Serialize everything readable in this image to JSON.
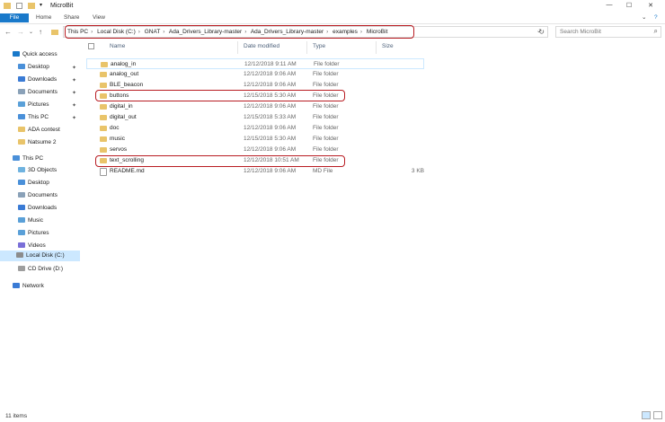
{
  "window": {
    "title": "MicroBit",
    "controls": {
      "minimize": "—",
      "maximize": "☐",
      "close": "✕"
    }
  },
  "ribbon": {
    "tabs": [
      "File",
      "Home",
      "Share",
      "View"
    ],
    "expand": "⌄",
    "help": "?"
  },
  "nav": {
    "back": "←",
    "forward": "→",
    "recent": "⌄",
    "up": "↑",
    "breadcrumb": [
      "This PC",
      "Local Disk (C:)",
      "GNAT",
      "Ada_Drivers_Library-master",
      "Ada_Drivers_Library-master",
      "examples",
      "MicroBit"
    ],
    "refresh": "↻",
    "search_placeholder": "Search MicroBit"
  },
  "sidebar": {
    "quick_access": "Quick access",
    "quick_items": [
      "Desktop",
      "Downloads",
      "Documents",
      "Pictures",
      "This PC",
      "ADA contest",
      "Natsume 2"
    ],
    "this_pc": "This PC",
    "pc_items": [
      "3D Objects",
      "Desktop",
      "Documents",
      "Downloads",
      "Music",
      "Pictures",
      "Videos",
      "Local Disk (C:)",
      "CD Drive (D:)"
    ],
    "network": "Network"
  },
  "columns": {
    "name": "Name",
    "date": "Date modified",
    "type": "Type",
    "size": "Size"
  },
  "files": [
    {
      "name": "analog_in",
      "date": "12/12/2018 9:11 AM",
      "type": "File folder",
      "size": ""
    },
    {
      "name": "analog_out",
      "date": "12/12/2018 9:06 AM",
      "type": "File folder",
      "size": ""
    },
    {
      "name": "BLE_beacon",
      "date": "12/12/2018 9:06 AM",
      "type": "File folder",
      "size": ""
    },
    {
      "name": "buttons",
      "date": "12/15/2018 5:30 AM",
      "type": "File folder",
      "size": ""
    },
    {
      "name": "digital_in",
      "date": "12/12/2018 9:06 AM",
      "type": "File folder",
      "size": ""
    },
    {
      "name": "digital_out",
      "date": "12/15/2018 5:33 AM",
      "type": "File folder",
      "size": ""
    },
    {
      "name": "doc",
      "date": "12/12/2018 9:06 AM",
      "type": "File folder",
      "size": ""
    },
    {
      "name": "music",
      "date": "12/15/2018 5:30 AM",
      "type": "File folder",
      "size": ""
    },
    {
      "name": "servos",
      "date": "12/12/2018 9:06 AM",
      "type": "File folder",
      "size": ""
    },
    {
      "name": "text_scrolling",
      "date": "12/12/2018 10:51 AM",
      "type": "File folder",
      "size": ""
    },
    {
      "name": "README.md",
      "date": "12/12/2018 9:06 AM",
      "type": "MD File",
      "size": "3 KB"
    }
  ],
  "status": {
    "count": "11 items"
  },
  "colors": {
    "accent": "#1979ca",
    "highlight": "#b81c22",
    "folder": "#e9c46a",
    "selected": "#cce8ff"
  }
}
